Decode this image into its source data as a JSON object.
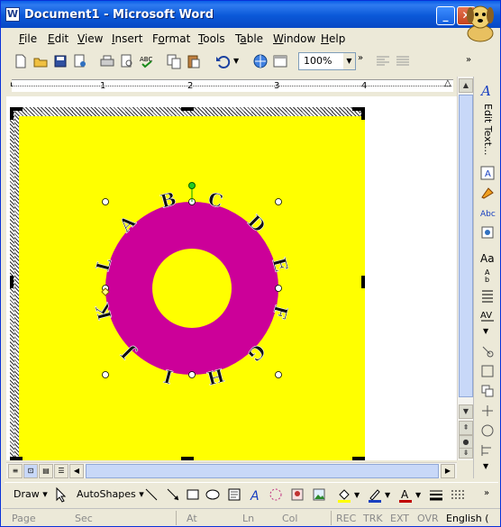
{
  "titlebar": {
    "icon_letter": "W",
    "title": "Document1 - Microsoft Word",
    "minimize": "_",
    "close": "✕"
  },
  "menu": [
    "File",
    "Edit",
    "View",
    "Insert",
    "Format",
    "Tools",
    "Table",
    "Window",
    "Help"
  ],
  "menu_underline": [
    "F",
    "E",
    "V",
    "I",
    "o",
    "T",
    "a",
    "W",
    "H"
  ],
  "toolbar": {
    "zoom_value": "100%"
  },
  "ruler": {
    "numbers": [
      "1",
      "2",
      "3",
      "4"
    ]
  },
  "wordart": {
    "letters": [
      "A",
      "B",
      "C",
      "D",
      "E",
      "F",
      "G",
      "H",
      "I",
      "J",
      "K",
      "L"
    ],
    "ring_color": "#cc0099",
    "background_color": "#ffff00"
  },
  "right_pane": {
    "edit_text": "Edit Text..."
  },
  "drawing": {
    "draw_label": "Draw",
    "autoshapes_label": "AutoShapes"
  },
  "status": {
    "page": "Page",
    "sec": "Sec",
    "at": "At",
    "ln": "Ln",
    "col": "Col",
    "rec": "REC",
    "trk": "TRK",
    "ext": "EXT",
    "ovr": "OVR",
    "language": "English ("
  }
}
